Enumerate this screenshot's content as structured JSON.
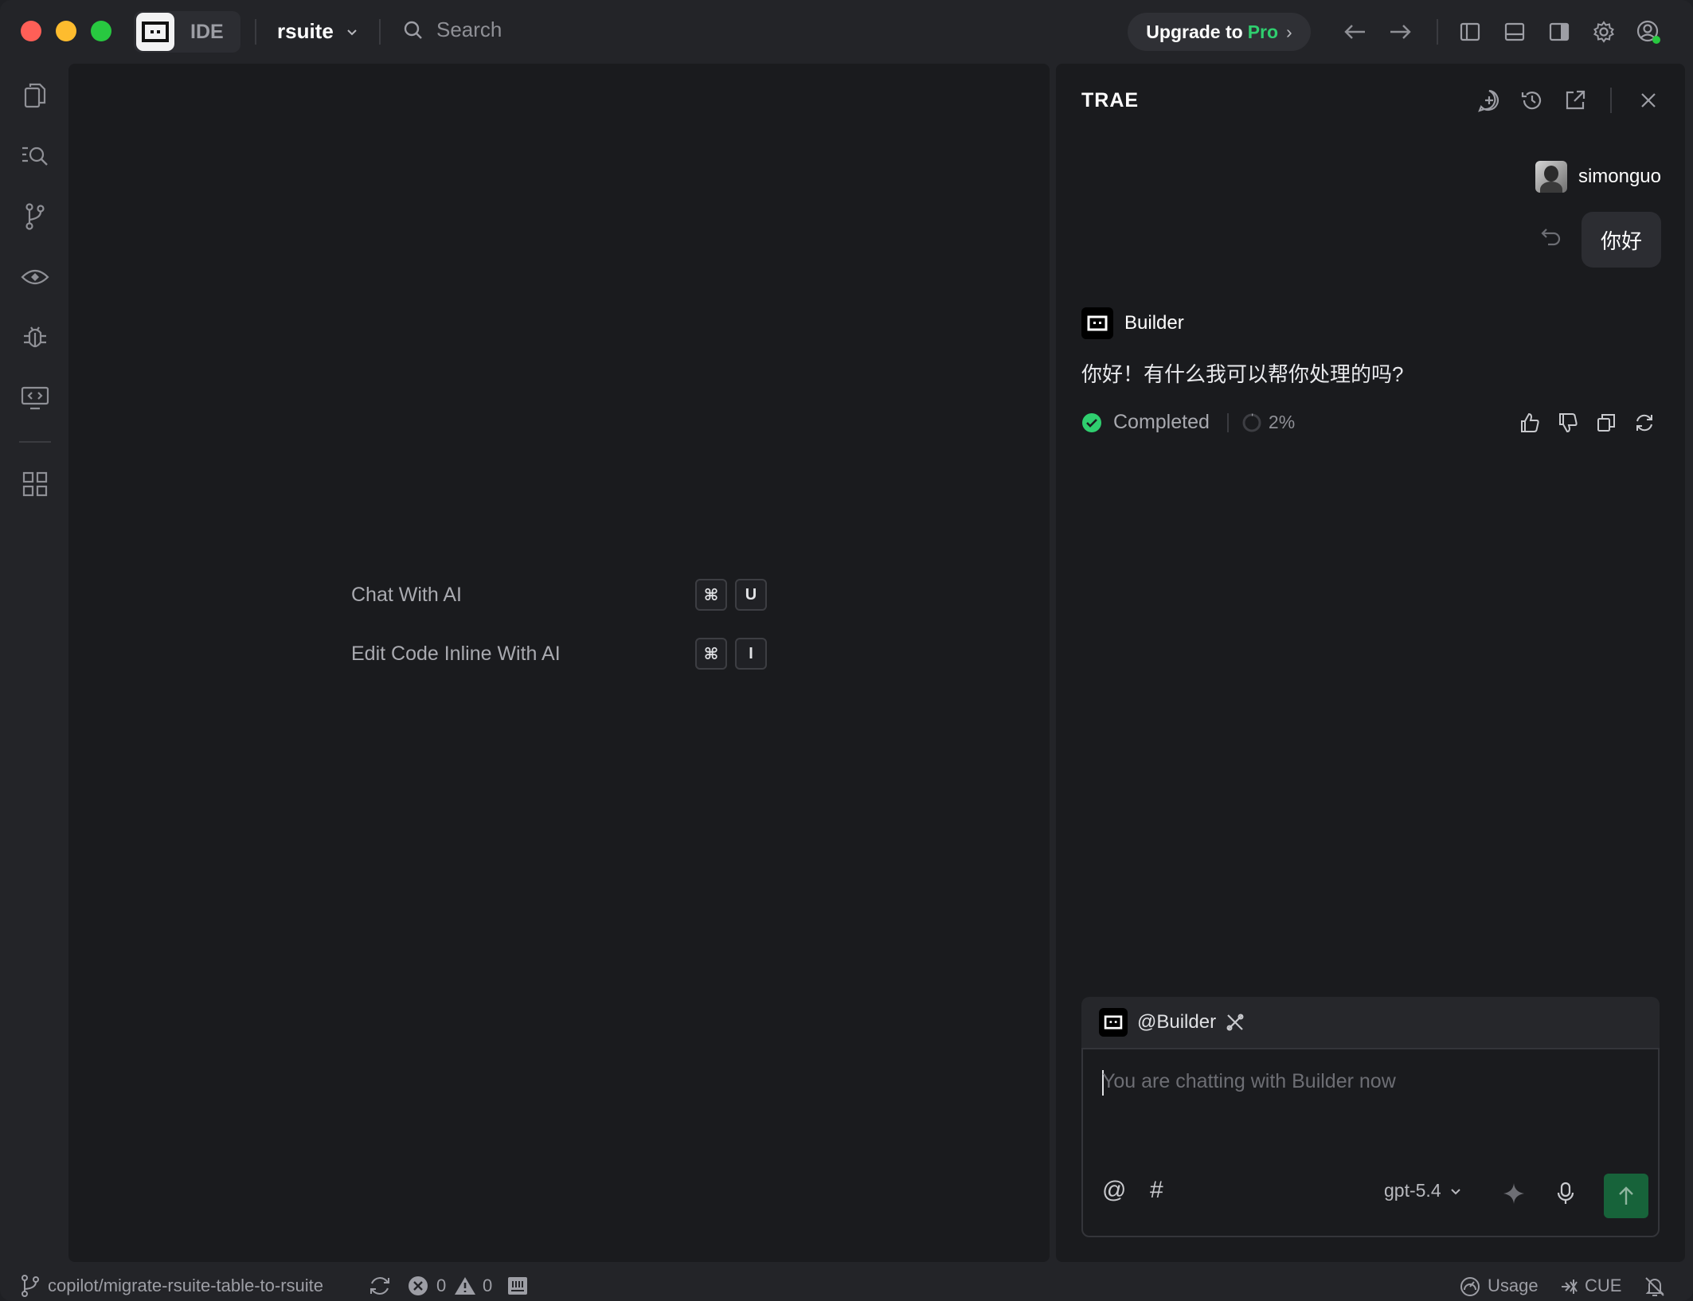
{
  "window": {
    "traffic_lights": [
      "#ff5f57",
      "#febc2e",
      "#28c840"
    ],
    "app_mode": "IDE",
    "project": "rsuite",
    "search_placeholder": "Search",
    "upgrade": {
      "prefix": "Upgrade to",
      "highlight": "Pro",
      "chevron": "›"
    },
    "accent_green": "#2fcf6f"
  },
  "activity_bar": {
    "items": [
      "files-icon",
      "search-icon",
      "source-control-icon",
      "preview-icon",
      "debug-icon",
      "remote-icon",
      "extensions-icon"
    ]
  },
  "editor": {
    "shortcuts": [
      {
        "label": "Chat With AI",
        "keys": [
          "⌘",
          "U"
        ]
      },
      {
        "label": "Edit Code Inline With AI",
        "keys": [
          "⌘",
          "I"
        ]
      }
    ]
  },
  "chat": {
    "title": "TRAE",
    "user": {
      "name": "simonguo",
      "message": "你好"
    },
    "bot": {
      "name": "Builder",
      "reply": "你好！有什么我可以帮你处理的吗?",
      "status": "Completed",
      "progress": "2%"
    },
    "composer": {
      "agent": "@Builder",
      "placeholder": "You are chatting with Builder now",
      "at_symbol": "@",
      "hash_symbol": "#",
      "model": "gpt-5.4"
    }
  },
  "status_bar": {
    "branch": "copilot/migrate-rsuite-table-to-rsuite",
    "errors": "0",
    "warnings": "0",
    "usage": "Usage",
    "cue": "CUE"
  }
}
